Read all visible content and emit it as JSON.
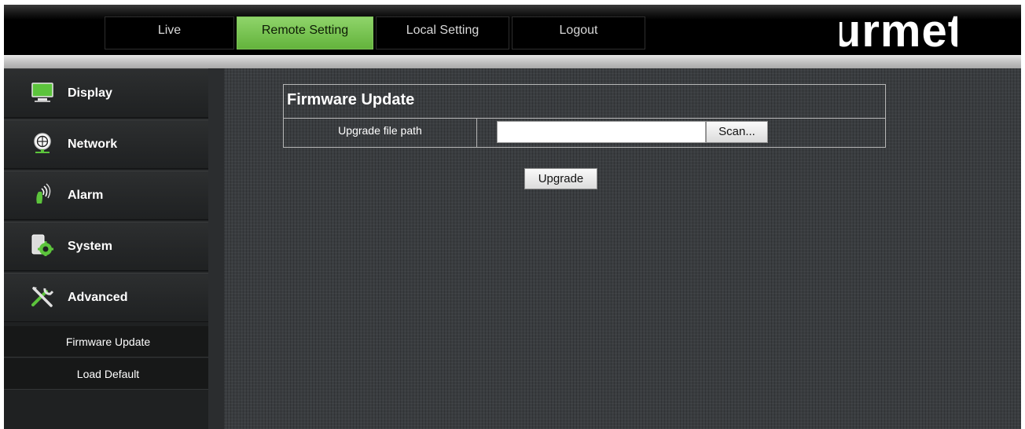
{
  "header": {
    "tabs": [
      {
        "label": "Live",
        "active": false
      },
      {
        "label": "Remote Setting",
        "active": true
      },
      {
        "label": "Local Setting",
        "active": false
      },
      {
        "label": "Logout",
        "active": false
      }
    ],
    "logo_text": "urmet"
  },
  "sidebar": {
    "items": [
      {
        "label": "Display",
        "icon": "monitor-icon"
      },
      {
        "label": "Network",
        "icon": "globe-network-icon"
      },
      {
        "label": "Alarm",
        "icon": "alarm-siren-icon"
      },
      {
        "label": "System",
        "icon": "system-gear-icon"
      },
      {
        "label": "Advanced",
        "icon": "tools-icon"
      }
    ],
    "subitems": [
      {
        "label": "Firmware Update"
      },
      {
        "label": "Load Default"
      }
    ]
  },
  "main": {
    "title": "Firmware Update",
    "row_label": "Upgrade file path",
    "path_value": "",
    "scan_label": "Scan...",
    "upgrade_label": "Upgrade"
  },
  "colors": {
    "active_tab": "#63b33c",
    "content_bg": "#3a3d40",
    "sidebar_bg": "#1f2122"
  }
}
